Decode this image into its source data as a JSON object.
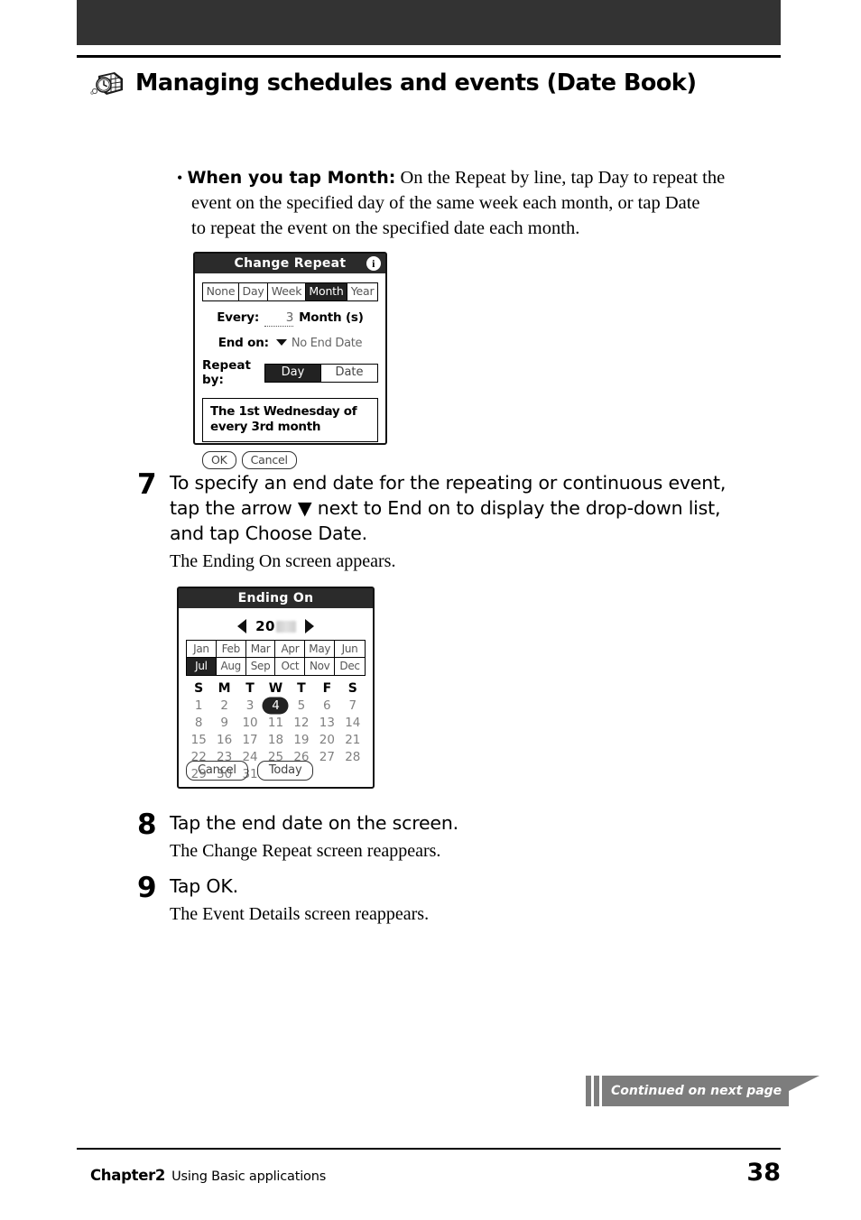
{
  "header": {
    "icon": "date-book-icon",
    "title": "Managing schedules and events (Date Book)"
  },
  "bullet": {
    "marker": "•",
    "lead": "When you tap Month:",
    "line1_rest": " On the Repeat by line, tap Day to repeat the",
    "line2": "event on the specified day of the same week each month, or tap Date",
    "line3": "to repeat the event on the specified date each month."
  },
  "change_repeat": {
    "title": "Change Repeat",
    "info_icon": "info-icon",
    "tabs": [
      {
        "label": "None",
        "selected": false
      },
      {
        "label": "Day",
        "selected": false
      },
      {
        "label": "Week",
        "selected": false
      },
      {
        "label": "Month",
        "selected": true
      },
      {
        "label": "Year",
        "selected": false
      }
    ],
    "every_label": "Every:",
    "every_value": "3",
    "every_unit": "Month (s)",
    "end_on_label": "End on:",
    "end_on_value": "No End Date",
    "repeat_by_label": "Repeat by:",
    "repeat_by": [
      {
        "label": "Day",
        "selected": true
      },
      {
        "label": "Date",
        "selected": false
      }
    ],
    "description_line1": "The 1st Wednesday of",
    "description_line2": "every 3rd month",
    "ok_label": "OK",
    "cancel_label": "Cancel"
  },
  "steps": [
    {
      "number": "7",
      "title_a": "To specify an end date for the repeating or continuous event,",
      "title_b": "tap the arrow ▼ next to End on to display the drop-down list,",
      "title_c": "and tap Choose Date.",
      "sub": "The Ending On screen appears."
    },
    {
      "number": "8",
      "title": "Tap the end date on the screen.",
      "sub": "The Change Repeat screen reappears."
    },
    {
      "number": "9",
      "title": "Tap OK.",
      "sub": "The Event Details screen reappears."
    }
  ],
  "ending_on": {
    "title": "Ending On",
    "prev_icon": "triangle-left-icon",
    "next_icon": "triangle-right-icon",
    "year_visible": "20",
    "year_redacted": true,
    "months": [
      {
        "label": "Jan",
        "selected": false
      },
      {
        "label": "Feb",
        "selected": false
      },
      {
        "label": "Mar",
        "selected": false
      },
      {
        "label": "Apr",
        "selected": false
      },
      {
        "label": "May",
        "selected": false
      },
      {
        "label": "Jun",
        "selected": false
      },
      {
        "label": "Jul",
        "selected": true
      },
      {
        "label": "Aug",
        "selected": false
      },
      {
        "label": "Sep",
        "selected": false
      },
      {
        "label": "Oct",
        "selected": false
      },
      {
        "label": "Nov",
        "selected": false
      },
      {
        "label": "Dec",
        "selected": false
      }
    ],
    "weekday_headers": [
      "S",
      "M",
      "T",
      "W",
      "T",
      "F",
      "S"
    ],
    "days": [
      {
        "n": "1",
        "selected": false
      },
      {
        "n": "2",
        "selected": false
      },
      {
        "n": "3",
        "selected": false
      },
      {
        "n": "4",
        "selected": true
      },
      {
        "n": "5",
        "selected": false
      },
      {
        "n": "6",
        "selected": false
      },
      {
        "n": "7",
        "selected": false
      },
      {
        "n": "8",
        "selected": false
      },
      {
        "n": "9",
        "selected": false
      },
      {
        "n": "10",
        "selected": false
      },
      {
        "n": "11",
        "selected": false
      },
      {
        "n": "12",
        "selected": false
      },
      {
        "n": "13",
        "selected": false
      },
      {
        "n": "14",
        "selected": false
      },
      {
        "n": "15",
        "selected": false
      },
      {
        "n": "16",
        "selected": false
      },
      {
        "n": "17",
        "selected": false
      },
      {
        "n": "18",
        "selected": false
      },
      {
        "n": "19",
        "selected": false
      },
      {
        "n": "20",
        "selected": false
      },
      {
        "n": "21",
        "selected": false
      },
      {
        "n": "22",
        "selected": false
      },
      {
        "n": "23",
        "selected": false
      },
      {
        "n": "24",
        "selected": false
      },
      {
        "n": "25",
        "selected": false
      },
      {
        "n": "26",
        "selected": false
      },
      {
        "n": "27",
        "selected": false
      },
      {
        "n": "28",
        "selected": false
      },
      {
        "n": "29",
        "selected": false
      },
      {
        "n": "30",
        "selected": false
      },
      {
        "n": "31",
        "selected": false
      },
      {
        "n": "",
        "selected": false
      },
      {
        "n": "",
        "selected": false
      },
      {
        "n": "",
        "selected": false
      },
      {
        "n": "",
        "selected": false
      }
    ],
    "cancel_label": "Cancel",
    "today_label": "Today"
  },
  "continued_banner": {
    "text": "Continued on next page",
    "color": "#7d7d7d"
  },
  "footer": {
    "chapter": "Chapter2",
    "subtitle": "Using Basic applications",
    "page": "38"
  }
}
